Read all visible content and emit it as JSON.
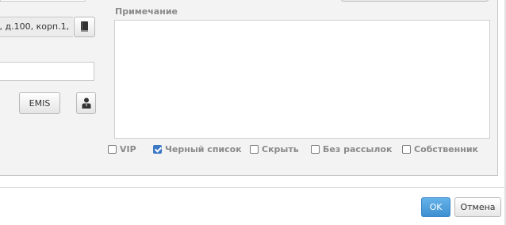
{
  "form": {
    "address_value": "в, д.100, корп.1,",
    "note_label": "Примечание",
    "note_value": "",
    "emis_label": "EMIS",
    "address_book_icon": "address-book-icon",
    "person_icon": "person-icon"
  },
  "flags": [
    {
      "label": "VIP",
      "checked": false
    },
    {
      "label": "Черный список",
      "checked": true
    },
    {
      "label": "Скрыть",
      "checked": false
    },
    {
      "label": "Без рассылок",
      "checked": false
    },
    {
      "label": "Собственник",
      "checked": false
    }
  ],
  "footer": {
    "ok_label": "OK",
    "cancel_label": "Отмена"
  },
  "colors": {
    "primary": "#4a9ad9",
    "panel_bg": "#f3f3f3",
    "checkbox_checked": "#3c78c4"
  }
}
